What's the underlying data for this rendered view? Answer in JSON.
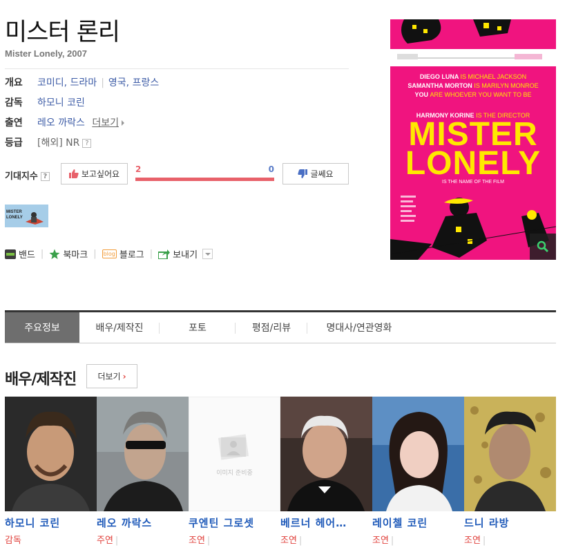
{
  "movie": {
    "title": "미스터 론리",
    "subtitle": "Mister Lonely, 2007"
  },
  "info": {
    "overview_label": "개요",
    "genre": "코미디, 드라마",
    "country": "영국, 프랑스",
    "director_label": "감독",
    "director": "하모니 코린",
    "cast_label": "출연",
    "cast": "레오 까락스",
    "cast_more": "더보기",
    "rating_label": "등급",
    "rating": "[해외] NR",
    "help": "?"
  },
  "expectation": {
    "label": "기대지수",
    "want_label": "보고싶어요",
    "dislike_label": "글쎄요",
    "want_count": "2",
    "dislike_count": "0",
    "want_ratio": 1.0
  },
  "share": {
    "band": "밴드",
    "bookmark": "북마크",
    "blog_badge": "blog",
    "blog": "블로그",
    "send": "보내기"
  },
  "poster": {
    "line1a": "DIEGO LUNA",
    "line1b": "IS MICHAEL JACKSON",
    "line2a": "SAMANTHA MORTON",
    "line2b": "IS MARILYN MONROE",
    "line3a": "YOU",
    "line3b": "ARE WHOEVER YOU WANT TO BE",
    "director_line_a": "HARMONY KORINE",
    "director_line_b": "IS THE DIRECTOR",
    "big1": "MISTER",
    "big2": "LONELY",
    "tagline": "IS THE NAME OF THE FILM",
    "thumb_text": "MISTER LONELY"
  },
  "tabs": [
    "주요정보",
    "배우/제작진",
    "포토",
    "평점/리뷰",
    "명대사/연관영화"
  ],
  "section": {
    "title": "배우/제작진",
    "more": "더보기"
  },
  "cast_list": [
    {
      "name": "하모니 코린",
      "role": "감독"
    },
    {
      "name": "레오 까락스",
      "role": "주연"
    },
    {
      "name": "쿠엔틴 그로셋",
      "role": "조연"
    },
    {
      "name": "베르너 헤어…",
      "role": "조연"
    },
    {
      "name": "레이첼 코린",
      "role": "조연"
    },
    {
      "name": "드니 라방",
      "role": "조연"
    }
  ],
  "placeholder_text": "이미지 준비중",
  "colors": {
    "link": "#3c5ba6",
    "cast_name": "#1f5ab9",
    "role": "#e0403b",
    "want": "#e8616a",
    "poster_bg": "#f0147f",
    "poster_text": "#ffe800"
  }
}
